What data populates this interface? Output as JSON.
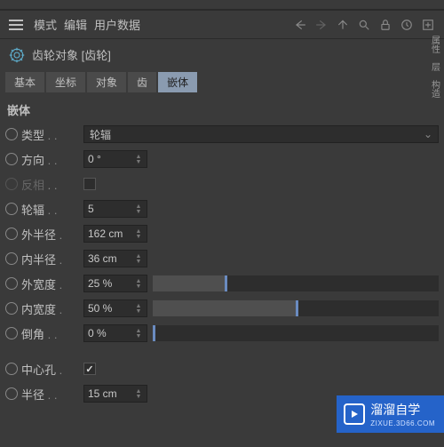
{
  "menu": {
    "mode": "模式",
    "edit": "编辑",
    "user_data": "用户数据"
  },
  "object": {
    "title": "齿轮对象 [齿轮]"
  },
  "tabs": {
    "basic": "基本",
    "coord": "坐标",
    "object": "对象",
    "teeth": "齿",
    "inlay": "嵌体"
  },
  "section": {
    "inlay": "嵌体"
  },
  "props": {
    "type_label": "类型",
    "type_value": "轮辐",
    "direction_label": "方向",
    "direction_value": "0 °",
    "invert_label": "反相",
    "spokes_label": "轮辐",
    "spokes_value": "5",
    "outer_radius_label": "外半径",
    "outer_radius_value": "162 cm",
    "inner_radius_label": "内半径",
    "inner_radius_value": "36 cm",
    "outer_width_label": "外宽度",
    "outer_width_value": "25 %",
    "inner_width_label": "内宽度",
    "inner_width_value": "50 %",
    "bevel_label": "倒角",
    "bevel_value": "0 %",
    "center_hole_label": "中心孔",
    "radius_label": "半径",
    "radius_value": "15 cm"
  },
  "rail": {
    "attr": "属性",
    "layer": "层",
    "structure": "构造"
  },
  "watermark": {
    "title": "溜溜自学",
    "sub": "ZIXUE.3D66.COM"
  }
}
